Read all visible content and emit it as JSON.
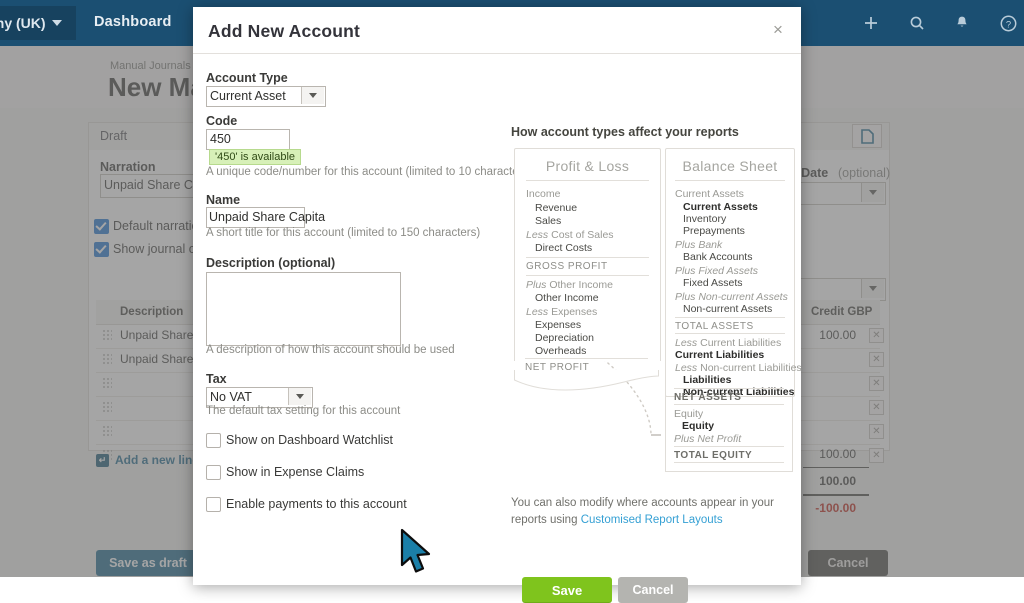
{
  "topnav": {
    "org": "any (UK)",
    "links": [
      {
        "label": "Dashboard"
      }
    ],
    "icons": [
      {
        "name": "plus-icon",
        "glyph": "+"
      },
      {
        "name": "search-icon",
        "glyph": "⌕"
      },
      {
        "name": "notifications-bell-icon",
        "glyph": "🔔"
      },
      {
        "name": "help-icon",
        "glyph": "?"
      }
    ],
    "accent": "#1b4f72"
  },
  "background": {
    "breadcrumb": "Manual Journals ›",
    "page_title": "New Manua",
    "status": "Draft",
    "narration_label": "Narration",
    "narration_value": "Unpaid Share Capital",
    "checkboxes": [
      {
        "label": "Default narration t",
        "checked": true
      },
      {
        "label": "Show journal on ca",
        "checked": true
      }
    ],
    "date_label": "g Date",
    "date_optional": "(optional)",
    "table": {
      "columns": [
        "Description",
        "Credit GBP"
      ],
      "rows": [
        {
          "description": "Unpaid Share C",
          "credit": "100.00"
        },
        {
          "description": "Unpaid Share C",
          "credit": ""
        },
        {
          "description": "",
          "credit": ""
        },
        {
          "description": "",
          "credit": ""
        },
        {
          "description": "",
          "credit": ""
        },
        {
          "description": "",
          "credit": ""
        }
      ],
      "subtotal": "100.00",
      "total": "100.00",
      "difference": "-100.00"
    },
    "add_line_label": "Add a new line",
    "save_draft_label": "Save as draft",
    "cancel_label": "Cancel"
  },
  "modal": {
    "title": "Add New Account",
    "close_label": "×",
    "fields": {
      "account_type_label": "Account Type",
      "account_type_value": "Current Asset",
      "code_label": "Code",
      "code_value": "450",
      "code_available": "'450' is available",
      "code_hint": "A unique code/number for this account (limited to 10 characters)",
      "name_label": "Name",
      "name_value": "Unpaid Share Capita",
      "name_hint": "A short title for this account (limited to 150 characters)",
      "description_label": "Description (optional)",
      "description_value": "",
      "description_hint": "A description of how this account should be used",
      "tax_label": "Tax",
      "tax_value": "No VAT",
      "tax_hint": "The default tax setting for this account"
    },
    "checkboxes": [
      {
        "label": "Show on Dashboard Watchlist",
        "checked": false
      },
      {
        "label": "Show in Expense Claims",
        "checked": false
      },
      {
        "label": "Enable payments to this account",
        "checked": false
      }
    ],
    "save_label": "Save",
    "cancel_label": "Cancel",
    "save_color": "#7fc41d",
    "explain": {
      "heading": "How account types affect your reports",
      "pl": {
        "title": "Profit & Loss",
        "lines": [
          {
            "kind": "group",
            "prefix": "",
            "text": "Income"
          },
          {
            "kind": "item",
            "text": "Revenue"
          },
          {
            "kind": "item",
            "text": "Sales"
          },
          {
            "kind": "group",
            "prefix": "Less ",
            "text": "Cost of Sales"
          },
          {
            "kind": "item",
            "text": "Direct Costs"
          },
          {
            "kind": "total",
            "text": "GROSS PROFIT"
          },
          {
            "kind": "group",
            "prefix": "Plus ",
            "text": "Other Income"
          },
          {
            "kind": "item",
            "text": "Other Income"
          },
          {
            "kind": "group",
            "prefix": "Less ",
            "text": "Expenses"
          },
          {
            "kind": "item",
            "text": "Expenses"
          },
          {
            "kind": "item",
            "text": "Depreciation"
          },
          {
            "kind": "item",
            "text": "Overheads"
          },
          {
            "kind": "total",
            "text": "NET PROFIT"
          }
        ]
      },
      "bs": {
        "title": "Balance Sheet",
        "lines": [
          {
            "kind": "group",
            "prefix": "",
            "text": "Current Assets"
          },
          {
            "kind": "item",
            "text": "Current Assets",
            "selected": true
          },
          {
            "kind": "item",
            "text": "Inventory"
          },
          {
            "kind": "item",
            "text": "Prepayments"
          },
          {
            "kind": "group",
            "prefix": "Plus ",
            "text": "Bank"
          },
          {
            "kind": "item",
            "text": "Bank Accounts"
          },
          {
            "kind": "group",
            "prefix": "Plus ",
            "text": "Fixed Assets"
          },
          {
            "kind": "item",
            "text": "Fixed Assets"
          },
          {
            "kind": "group",
            "prefix": "Plus ",
            "text": "Non-current Assets"
          },
          {
            "kind": "item",
            "text": "Non-current Assets"
          },
          {
            "kind": "total",
            "text": "TOTAL ASSETS"
          },
          {
            "kind": "group",
            "prefix": "Less ",
            "text": "Current Liabilities"
          },
          {
            "kind": "item",
            "text": "Current Liabilities"
          },
          {
            "kind": "group",
            "prefix": "Less ",
            "text": "Non-current Liabilities"
          },
          {
            "kind": "item",
            "text": "Liabilities"
          },
          {
            "kind": "item",
            "text": "Non-current Liabilities"
          },
          {
            "kind": "total",
            "text": "NET ASSETS"
          },
          {
            "kind": "group",
            "prefix": "",
            "text": "Equity"
          },
          {
            "kind": "item",
            "text": "Equity"
          },
          {
            "kind": "group",
            "prefix": "Plus ",
            "text": "Net Profit"
          },
          {
            "kind": "total",
            "text": "TOTAL EQUITY"
          }
        ]
      },
      "note_text": "You can also modify where accounts appear in your reports using ",
      "note_link": "Customised Report Layouts"
    }
  }
}
